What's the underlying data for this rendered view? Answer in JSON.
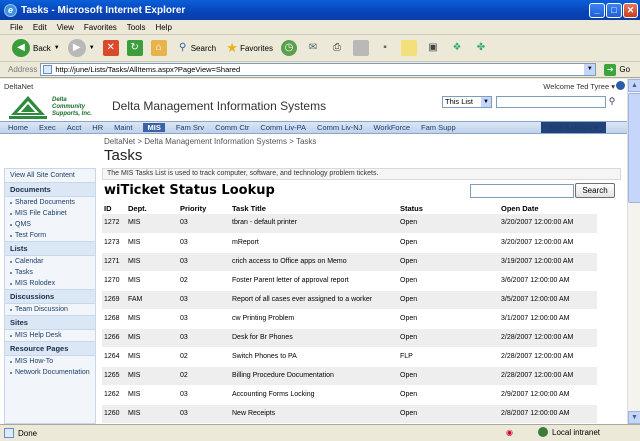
{
  "window": {
    "title": "Tasks - Microsoft Internet Explorer"
  },
  "menu": [
    "File",
    "Edit",
    "View",
    "Favorites",
    "Tools",
    "Help"
  ],
  "toolbar": {
    "back": "Back",
    "search": "Search",
    "favorites": "Favorites"
  },
  "address": {
    "label": "Address",
    "url": "http://june/Lists/Tasks/AllItems.aspx?PageView=Shared",
    "go": "Go"
  },
  "portal": {
    "site_name": "DeltaNet",
    "welcome": "Welcome Ted Tyree ▾",
    "logo_text": "Delta Community Supports, Inc.",
    "title": "Delta Management Information Systems",
    "scope": "This List",
    "nav": [
      "Home",
      "Exec",
      "Acct",
      "HR",
      "Maint",
      "MIS",
      "Fam Srv",
      "Comm Ctr",
      "Comm Liv-PA",
      "Comm Liv-NJ",
      "WorkForce",
      "Fam Supp"
    ],
    "nav_selected": "MIS",
    "site_actions": "Site Actions ▾",
    "breadcrumb": "DeltaNet > Delta Management Information Systems > Tasks",
    "page_title": "Tasks",
    "description": "The MIS Tasks List is used to track computer, software, and technology problem tickets."
  },
  "quicklaunch": {
    "view_all": "View All Site Content",
    "sections": [
      {
        "heading": "Documents",
        "items": [
          "Shared Documents",
          "MIS File Cabinet",
          "QMS",
          "Test Form"
        ]
      },
      {
        "heading": "Lists",
        "items": [
          "Calendar",
          "Tasks",
          "MIS Rolodex"
        ]
      },
      {
        "heading": "Discussions",
        "items": [
          "Team Discussion"
        ]
      },
      {
        "heading": "Sites",
        "items": [
          "MIS Help Desk"
        ]
      },
      {
        "heading": "Resource Pages",
        "items": [
          "MIS How-To",
          "Network Documentation"
        ]
      }
    ]
  },
  "webpart": {
    "title": "wiTicket Status Lookup",
    "search_button": "Search",
    "columns": [
      "ID",
      "Dept.",
      "Priority",
      "Task Title",
      "Status",
      "Open Date"
    ],
    "rows": [
      [
        "1272",
        "MIS",
        "03",
        "tbran - default printer",
        "Open",
        "3/20/2007 12:00:00 AM"
      ],
      [
        "1273",
        "MIS",
        "03",
        "mReport",
        "Open",
        "3/20/2007 12:00:00 AM"
      ],
      [
        "1271",
        "MIS",
        "03",
        "crich  access to Office apps on Memo",
        "Open",
        "3/19/2007 12:00:00 AM"
      ],
      [
        "1270",
        "MIS",
        "02",
        "Foster Parent letter of approval report",
        "Open",
        "3/6/2007 12:00:00 AM"
      ],
      [
        "1269",
        "FAM",
        "03",
        "Report of all cases ever assigned to a worker",
        "Open",
        "3/5/2007 12:00:00 AM"
      ],
      [
        "1268",
        "MIS",
        "03",
        "cw Printing Problem",
        "Open",
        "3/1/2007 12:00:00 AM"
      ],
      [
        "1266",
        "MIS",
        "03",
        "Desk for Br Phones",
        "Open",
        "2/28/2007 12:00:00 AM"
      ],
      [
        "1264",
        "MIS",
        "02",
        "Switch Phones to PA",
        "FLP",
        "2/28/2007 12:00:00 AM"
      ],
      [
        "1265",
        "MIS",
        "02",
        "Billing Procedure Documentation",
        "Open",
        "2/28/2007 12:00:00 AM"
      ],
      [
        "1262",
        "MIS",
        "03",
        "Accounting Forms Locking",
        "Open",
        "2/9/2007 12:00:00 AM"
      ],
      [
        "1260",
        "MIS",
        "03",
        "New Receipts",
        "Open",
        "2/8/2007 12:00:00 AM"
      ]
    ]
  },
  "status": {
    "left": "Done",
    "zone": "Local intranet"
  }
}
